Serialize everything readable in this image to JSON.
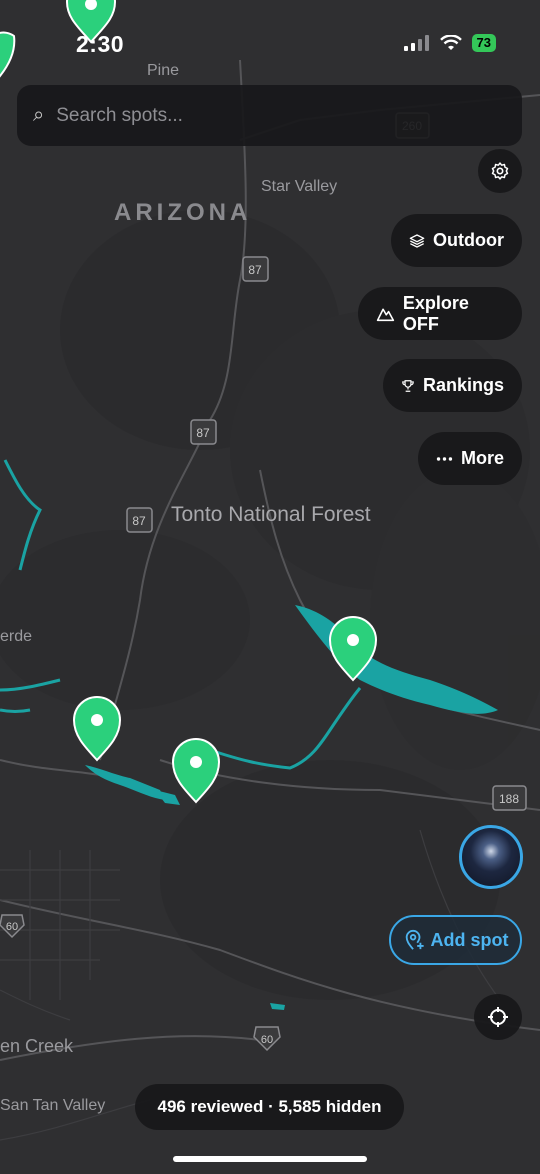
{
  "status_bar": {
    "time": "2:30",
    "battery": "73"
  },
  "search": {
    "placeholder": "Search spots..."
  },
  "buttons": {
    "outdoor": "Outdoor",
    "explore": "Explore OFF",
    "rankings": "Rankings",
    "more": "More",
    "add_spot": "Add spot"
  },
  "footer": {
    "counts": "496 reviewed · 5,585 hidden"
  },
  "map_labels": {
    "pine": "Pine",
    "star_valley": "Star Valley",
    "arizona": "ARIZONA",
    "tonto": "Tonto National Forest",
    "verde": "erde",
    "creek": "en Creek",
    "san_tan": "San Tan Valley"
  },
  "route_shields": {
    "r260": "260",
    "r87a": "87",
    "r87b": "87",
    "r87c": "87",
    "r188": "188",
    "r60a": "60",
    "r60b": "60"
  },
  "colors": {
    "map_bg": "#2f2f31",
    "water": "#1aa3a3",
    "marker": "#2bd07c",
    "accent": "#3aa7e6"
  }
}
